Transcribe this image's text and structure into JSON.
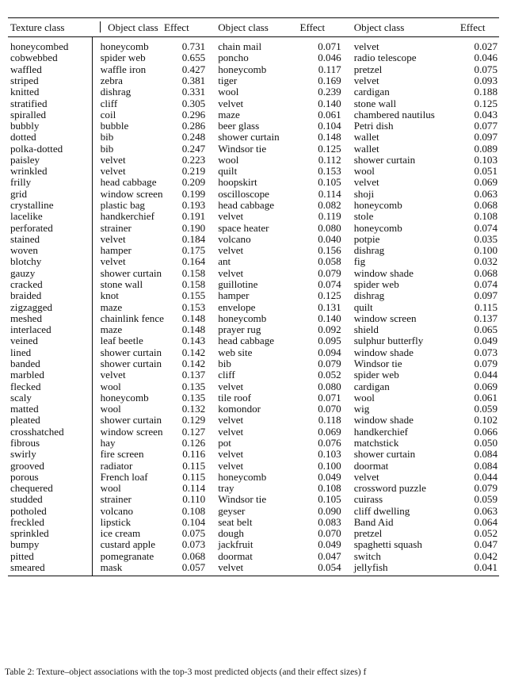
{
  "document": {
    "clipped_header_line": "",
    "caption": "Table 2: Texture–object associations with the top-3 most predicted objects (and their effect sizes) f"
  },
  "table": {
    "headers": [
      "Texture class",
      "Object class",
      "Effect",
      "Object class",
      "Effect",
      "Object class",
      "Effect"
    ],
    "rows": [
      {
        "texture": "honeycombed",
        "obj1": "honeycomb",
        "eff1": "0.731",
        "obj2": "chain mail",
        "eff2": "0.071",
        "obj3": "velvet",
        "eff3": "0.027"
      },
      {
        "texture": "cobwebbed",
        "obj1": "spider web",
        "eff1": "0.655",
        "obj2": "poncho",
        "eff2": "0.046",
        "obj3": "radio telescope",
        "eff3": "0.046"
      },
      {
        "texture": "waffled",
        "obj1": "waffle iron",
        "eff1": "0.427",
        "obj2": "honeycomb",
        "eff2": "0.117",
        "obj3": "pretzel",
        "eff3": "0.075"
      },
      {
        "texture": "striped",
        "obj1": "zebra",
        "eff1": "0.381",
        "obj2": "tiger",
        "eff2": "0.169",
        "obj3": "velvet",
        "eff3": "0.093"
      },
      {
        "texture": "knitted",
        "obj1": "dishrag",
        "eff1": "0.331",
        "obj2": "wool",
        "eff2": "0.239",
        "obj3": "cardigan",
        "eff3": "0.188"
      },
      {
        "texture": "stratified",
        "obj1": "cliff",
        "eff1": "0.305",
        "obj2": "velvet",
        "eff2": "0.140",
        "obj3": "stone wall",
        "eff3": "0.125"
      },
      {
        "texture": "spiralled",
        "obj1": "coil",
        "eff1": "0.296",
        "obj2": "maze",
        "eff2": "0.061",
        "obj3": "chambered nautilus",
        "eff3": "0.043"
      },
      {
        "texture": "bubbly",
        "obj1": "bubble",
        "eff1": "0.286",
        "obj2": "beer glass",
        "eff2": "0.104",
        "obj3": "Petri dish",
        "eff3": "0.077"
      },
      {
        "texture": "dotted",
        "obj1": "bib",
        "eff1": "0.248",
        "obj2": "shower curtain",
        "eff2": "0.148",
        "obj3": "wallet",
        "eff3": "0.097"
      },
      {
        "texture": "polka-dotted",
        "obj1": "bib",
        "eff1": "0.247",
        "obj2": "Windsor tie",
        "eff2": "0.125",
        "obj3": "wallet",
        "eff3": "0.089"
      },
      {
        "texture": "paisley",
        "obj1": "velvet",
        "eff1": "0.223",
        "obj2": "wool",
        "eff2": "0.112",
        "obj3": "shower curtain",
        "eff3": "0.103"
      },
      {
        "texture": "wrinkled",
        "obj1": "velvet",
        "eff1": "0.219",
        "obj2": "quilt",
        "eff2": "0.153",
        "obj3": "wool",
        "eff3": "0.051"
      },
      {
        "texture": "frilly",
        "obj1": "head cabbage",
        "eff1": "0.209",
        "obj2": "hoopskirt",
        "eff2": "0.105",
        "obj3": "velvet",
        "eff3": "0.069"
      },
      {
        "texture": "grid",
        "obj1": "window screen",
        "eff1": "0.199",
        "obj2": "oscilloscope",
        "eff2": "0.114",
        "obj3": "shoji",
        "eff3": "0.063"
      },
      {
        "texture": "crystalline",
        "obj1": "plastic bag",
        "eff1": "0.193",
        "obj2": "head cabbage",
        "eff2": "0.082",
        "obj3": "honeycomb",
        "eff3": "0.068"
      },
      {
        "texture": "lacelike",
        "obj1": "handkerchief",
        "eff1": "0.191",
        "obj2": "velvet",
        "eff2": "0.119",
        "obj3": "stole",
        "eff3": "0.108"
      },
      {
        "texture": "perforated",
        "obj1": "strainer",
        "eff1": "0.190",
        "obj2": "space heater",
        "eff2": "0.080",
        "obj3": "honeycomb",
        "eff3": "0.074"
      },
      {
        "texture": "stained",
        "obj1": "velvet",
        "eff1": "0.184",
        "obj2": "volcano",
        "eff2": "0.040",
        "obj3": "potpie",
        "eff3": "0.035"
      },
      {
        "texture": "woven",
        "obj1": "hamper",
        "eff1": "0.175",
        "obj2": "velvet",
        "eff2": "0.156",
        "obj3": "dishrag",
        "eff3": "0.100"
      },
      {
        "texture": "blotchy",
        "obj1": "velvet",
        "eff1": "0.164",
        "obj2": "ant",
        "eff2": "0.058",
        "obj3": "fig",
        "eff3": "0.032"
      },
      {
        "texture": "gauzy",
        "obj1": "shower curtain",
        "eff1": "0.158",
        "obj2": "velvet",
        "eff2": "0.079",
        "obj3": "window shade",
        "eff3": "0.068"
      },
      {
        "texture": "cracked",
        "obj1": "stone wall",
        "eff1": "0.158",
        "obj2": "guillotine",
        "eff2": "0.074",
        "obj3": "spider web",
        "eff3": "0.074"
      },
      {
        "texture": "braided",
        "obj1": "knot",
        "eff1": "0.155",
        "obj2": "hamper",
        "eff2": "0.125",
        "obj3": "dishrag",
        "eff3": "0.097"
      },
      {
        "texture": "zigzagged",
        "obj1": "maze",
        "eff1": "0.153",
        "obj2": "envelope",
        "eff2": "0.131",
        "obj3": "quilt",
        "eff3": "0.115"
      },
      {
        "texture": "meshed",
        "obj1": "chainlink fence",
        "eff1": "0.148",
        "obj2": "honeycomb",
        "eff2": "0.140",
        "obj3": "window screen",
        "eff3": "0.137"
      },
      {
        "texture": "interlaced",
        "obj1": "maze",
        "eff1": "0.148",
        "obj2": "prayer rug",
        "eff2": "0.092",
        "obj3": "shield",
        "eff3": "0.065"
      },
      {
        "texture": "veined",
        "obj1": "leaf beetle",
        "eff1": "0.143",
        "obj2": "head cabbage",
        "eff2": "0.095",
        "obj3": "sulphur butterfly",
        "eff3": "0.049"
      },
      {
        "texture": "lined",
        "obj1": "shower curtain",
        "eff1": "0.142",
        "obj2": "web site",
        "eff2": "0.094",
        "obj3": "window shade",
        "eff3": "0.073"
      },
      {
        "texture": "banded",
        "obj1": "shower curtain",
        "eff1": "0.142",
        "obj2": "bib",
        "eff2": "0.079",
        "obj3": "Windsor tie",
        "eff3": "0.079"
      },
      {
        "texture": "marbled",
        "obj1": "velvet",
        "eff1": "0.137",
        "obj2": "cliff",
        "eff2": "0.052",
        "obj3": "spider web",
        "eff3": "0.044"
      },
      {
        "texture": "flecked",
        "obj1": "wool",
        "eff1": "0.135",
        "obj2": "velvet",
        "eff2": "0.080",
        "obj3": "cardigan",
        "eff3": "0.069"
      },
      {
        "texture": "scaly",
        "obj1": "honeycomb",
        "eff1": "0.135",
        "obj2": "tile roof",
        "eff2": "0.071",
        "obj3": "wool",
        "eff3": "0.061"
      },
      {
        "texture": "matted",
        "obj1": "wool",
        "eff1": "0.132",
        "obj2": "komondor",
        "eff2": "0.070",
        "obj3": "wig",
        "eff3": "0.059"
      },
      {
        "texture": "pleated",
        "obj1": "shower curtain",
        "eff1": "0.129",
        "obj2": "velvet",
        "eff2": "0.118",
        "obj3": "window shade",
        "eff3": "0.102"
      },
      {
        "texture": "crosshatched",
        "obj1": "window screen",
        "eff1": "0.127",
        "obj2": "velvet",
        "eff2": "0.069",
        "obj3": "handkerchief",
        "eff3": "0.066"
      },
      {
        "texture": "fibrous",
        "obj1": "hay",
        "eff1": "0.126",
        "obj2": "pot",
        "eff2": "0.076",
        "obj3": "matchstick",
        "eff3": "0.050"
      },
      {
        "texture": "swirly",
        "obj1": "fire screen",
        "eff1": "0.116",
        "obj2": "velvet",
        "eff2": "0.103",
        "obj3": "shower curtain",
        "eff3": "0.084"
      },
      {
        "texture": "grooved",
        "obj1": "radiator",
        "eff1": "0.115",
        "obj2": "velvet",
        "eff2": "0.100",
        "obj3": "doormat",
        "eff3": "0.084"
      },
      {
        "texture": "porous",
        "obj1": "French loaf",
        "eff1": "0.115",
        "obj2": "honeycomb",
        "eff2": "0.049",
        "obj3": "velvet",
        "eff3": "0.044"
      },
      {
        "texture": "chequered",
        "obj1": "wool",
        "eff1": "0.114",
        "obj2": "tray",
        "eff2": "0.108",
        "obj3": "crossword puzzle",
        "eff3": "0.079"
      },
      {
        "texture": "studded",
        "obj1": "strainer",
        "eff1": "0.110",
        "obj2": "Windsor tie",
        "eff2": "0.105",
        "obj3": "cuirass",
        "eff3": "0.059"
      },
      {
        "texture": "potholed",
        "obj1": "volcano",
        "eff1": "0.108",
        "obj2": "geyser",
        "eff2": "0.090",
        "obj3": "cliff dwelling",
        "eff3": "0.063"
      },
      {
        "texture": "freckled",
        "obj1": "lipstick",
        "eff1": "0.104",
        "obj2": "seat belt",
        "eff2": "0.083",
        "obj3": "Band Aid",
        "eff3": "0.064"
      },
      {
        "texture": "sprinkled",
        "obj1": "ice cream",
        "eff1": "0.075",
        "obj2": "dough",
        "eff2": "0.070",
        "obj3": "pretzel",
        "eff3": "0.052"
      },
      {
        "texture": "bumpy",
        "obj1": "custard apple",
        "eff1": "0.073",
        "obj2": "jackfruit",
        "eff2": "0.049",
        "obj3": "spaghetti squash",
        "eff3": "0.047"
      },
      {
        "texture": "pitted",
        "obj1": "pomegranate",
        "eff1": "0.068",
        "obj2": "doormat",
        "eff2": "0.047",
        "obj3": "switch",
        "eff3": "0.042"
      },
      {
        "texture": "smeared",
        "obj1": "mask",
        "eff1": "0.057",
        "obj2": "velvet",
        "eff2": "0.054",
        "obj3": "jellyfish",
        "eff3": "0.041"
      }
    ]
  }
}
